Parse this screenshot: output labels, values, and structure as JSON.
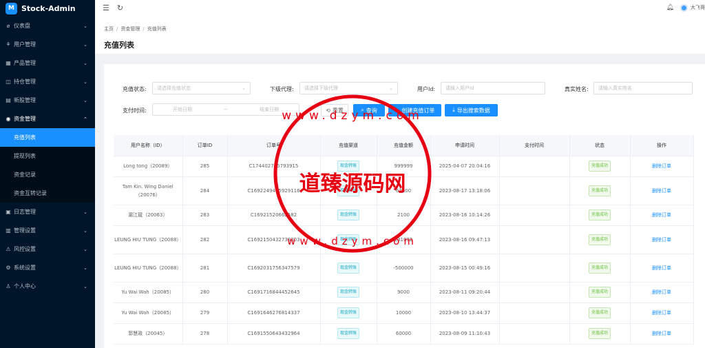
{
  "app": {
    "name": "Stock-Admin",
    "logo_text": "M"
  },
  "sidebar": {
    "items": [
      {
        "label": "仪表盘",
        "icon": "⌀"
      },
      {
        "label": "用户管理",
        "icon": "⚘"
      },
      {
        "label": "产品管理",
        "icon": "▦"
      },
      {
        "label": "持仓管理",
        "icon": "◫"
      },
      {
        "label": "新股管理",
        "icon": "▤"
      },
      {
        "label": "资金管理",
        "icon": "◉"
      },
      {
        "label": "日志管理",
        "icon": "▣"
      },
      {
        "label": "管理设置",
        "icon": "▥"
      },
      {
        "label": "风控设置",
        "icon": "⚠"
      },
      {
        "label": "系统设置",
        "icon": "⚙"
      },
      {
        "label": "个人中心",
        "icon": "♙"
      }
    ],
    "sub_items": [
      {
        "label": "充值列表"
      },
      {
        "label": "提现列表"
      },
      {
        "label": "资金记录"
      },
      {
        "label": "资金互转记录"
      }
    ]
  },
  "topbar": {
    "user_name": "大飞哥"
  },
  "breadcrumb": [
    "主页",
    "资金管理",
    "充值列表"
  ],
  "page_title": "充值列表",
  "filters": {
    "status_label": "充值状态:",
    "status_placeholder": "请选择充值状态",
    "agent_label": "下级代理:",
    "agent_placeholder": "请选择下级代理",
    "uid_label": "用户Id:",
    "uid_placeholder": "请输入用户Id",
    "name_label": "真实姓名:",
    "name_placeholder": "请输入真实姓名",
    "time_label": "支付时间:",
    "start_placeholder": "开始日期",
    "end_placeholder": "结束日期"
  },
  "buttons": {
    "reset": "重置",
    "search": "查询",
    "create": "创建充值订单",
    "export": "导出搜索数据"
  },
  "table": {
    "headers": [
      "用户名称（ID）",
      "订单ID",
      "订单号",
      "充值渠道",
      "充值金额",
      "申请时间",
      "支付时间",
      "状态",
      "操作"
    ],
    "rows": [
      {
        "user": "Long tong（20089）",
        "id": "285",
        "order": "C174402745793915",
        "channel": "现金转账",
        "amount": "999999",
        "apply": "2025-04-07 20:04:16",
        "pay": "",
        "status": "充值成功",
        "action": "删除订单"
      },
      {
        "user": "Tam Kin. Wing Daniel（20076）",
        "id": "284",
        "order": "C1692249465929116",
        "channel": "现金转账",
        "amount": "67800",
        "apply": "2023-08-17 13:18:06",
        "pay": "",
        "status": "充值成功",
        "action": "删除订单"
      },
      {
        "user": "漏江龍（20063）",
        "id": "283",
        "order": "C16921520662582",
        "channel": "现金转账",
        "amount": "2100",
        "apply": "2023-08-16 10:14:26",
        "pay": "",
        "status": "充值成功",
        "action": "删除订单"
      },
      {
        "user": "LEUNG HIU TUNG（20088）",
        "id": "282",
        "order": "C1692150432738303",
        "channel": "现金转账",
        "amount": "131032",
        "apply": "2023-08-16 09:47:13",
        "pay": "",
        "status": "充值成功",
        "action": "删除订单"
      },
      {
        "user": "LEUNG HIU TUNG（20088）",
        "id": "281",
        "order": "C1692031756347579",
        "channel": "现金转账",
        "amount": "-500000",
        "apply": "2023-08-15 00:49:16",
        "pay": "",
        "status": "充值成功",
        "action": "删除订单"
      },
      {
        "user": "Yu Wai Wah（20085）",
        "id": "280",
        "order": "C1691716844452645",
        "channel": "现金转账",
        "amount": "9000",
        "apply": "2023-08-11 09:20:44",
        "pay": "",
        "status": "充值成功",
        "action": "删除订单"
      },
      {
        "user": "Yu Wai Wah（20085）",
        "id": "279",
        "order": "C1691646276814337",
        "channel": "现金转账",
        "amount": "10000",
        "apply": "2023-08-10 13:44:37",
        "pay": "",
        "status": "充值成功",
        "action": "删除订单"
      },
      {
        "user": "郭慧政（20045）",
        "id": "278",
        "order": "C1691550643432964",
        "channel": "现金转账",
        "amount": "60000",
        "apply": "2023-08-09 11:10:43",
        "pay": "",
        "status": "充值成功",
        "action": "删除订单"
      }
    ]
  },
  "watermark": {
    "text": "道臻源码网",
    "url_text": "www.dzym.com"
  }
}
